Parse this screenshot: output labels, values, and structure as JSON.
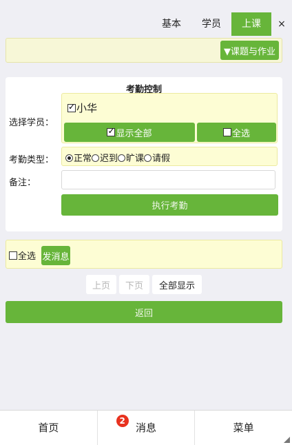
{
  "tabs": [
    {
      "label": "基本"
    },
    {
      "label": "学员"
    },
    {
      "label": "上课"
    }
  ],
  "close_label": "×",
  "topbar": {
    "lesson_button": "▼课题与作业"
  },
  "attendance": {
    "title": "考勤控制",
    "student_label": "选择学员：",
    "student_name": "小华",
    "show_all_button": "显示全部",
    "select_all_button": "全选",
    "type_label": "考勤类型：",
    "types": [
      {
        "label": "正常",
        "selected": true
      },
      {
        "label": "迟到",
        "selected": false
      },
      {
        "label": "旷课",
        "selected": false
      },
      {
        "label": "请假",
        "selected": false
      }
    ],
    "note_label": "备注：",
    "note_value": "",
    "execute_button": "执行考勤"
  },
  "messages": {
    "select_all_label": "全选",
    "send_button": "发消息"
  },
  "pager": {
    "prev": "上页",
    "next": "下页",
    "show_all": "全部显示"
  },
  "back_button": "返回",
  "nav": {
    "home": "首页",
    "messages": "消息",
    "messages_badge": "2",
    "menu": "菜单"
  },
  "colors": {
    "accent": "#67b53a",
    "highlight_bg": "#fdfdd4",
    "badge": "#e8321f"
  }
}
